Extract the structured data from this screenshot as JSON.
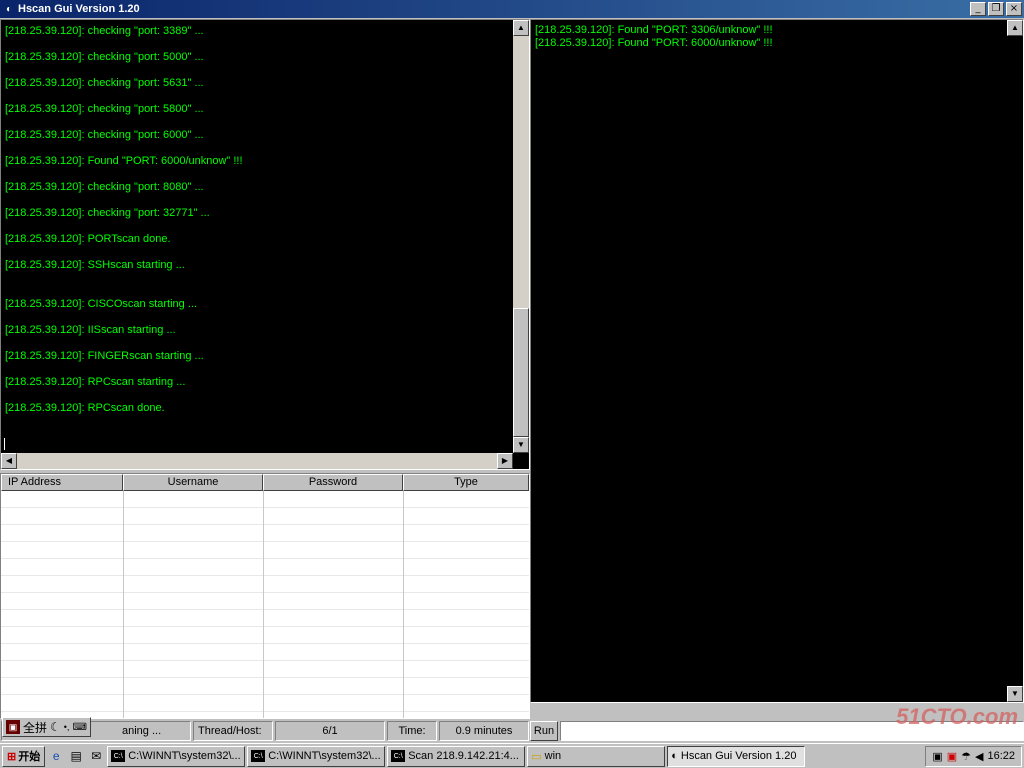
{
  "window": {
    "title": "Hscan Gui Version 1.20",
    "min_label": "_",
    "restore_label": "❐",
    "close_label": "×"
  },
  "left_log": [
    "[218.25.39.120]: checking \"port: 3389\" ...",
    "[218.25.39.120]: checking \"port: 5000\" ...",
    "[218.25.39.120]: checking \"port: 5631\" ...",
    "[218.25.39.120]: checking \"port: 5800\" ...",
    "[218.25.39.120]: checking \"port: 6000\" ...",
    "[218.25.39.120]: Found \"PORT: 6000/unknow\" !!!",
    "[218.25.39.120]: checking \"port: 8080\" ...",
    "[218.25.39.120]: checking \"port: 32771\" ...",
    "[218.25.39.120]: PORTscan done.",
    "[218.25.39.120]: SSHscan starting ...",
    "[218.25.39.120]: CISCOscan starting ...",
    "[218.25.39.120]: IISscan starting ...",
    "[218.25.39.120]: FINGERscan starting ...",
    "[218.25.39.120]: RPCscan starting ...",
    "[218.25.39.120]: RPCscan done."
  ],
  "right_log": [
    "[218.25.39.120]: Found \"PORT: 3306/unknow\" !!!",
    "[218.25.39.120]: Found \"PORT: 6000/unknow\" !!!"
  ],
  "grid": {
    "columns": [
      "IP Address",
      "Username",
      "Password",
      "Type"
    ]
  },
  "status": {
    "scan_text": "aning ...",
    "thread_label": "Thread/Host:",
    "thread_value": "6/1",
    "time_label": "Time:",
    "time_value": "0.9 minutes"
  },
  "run": {
    "button_label": "Run",
    "command_value": ""
  },
  "ime": {
    "mode_label": "全拼"
  },
  "taskbar": {
    "start_label": "开始",
    "tasks": [
      {
        "label": "C:\\WINNT\\system32\\...",
        "active": false
      },
      {
        "label": "C:\\WINNT\\system32\\...",
        "active": false
      },
      {
        "label": "Scan 218.9.142.21:4...",
        "active": false
      },
      {
        "label": "win",
        "active": false
      },
      {
        "label": "Hscan Gui Version 1.20",
        "active": true
      }
    ],
    "clock": "16:22"
  },
  "watermark": "51CTO.com",
  "colors": {
    "log_text": "#00ff00",
    "log_bg": "#000000",
    "title_bar": "#0a246a"
  }
}
